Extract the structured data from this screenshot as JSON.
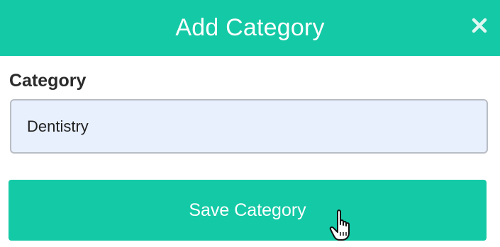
{
  "modal": {
    "title": "Add Category",
    "close_icon": "close-icon"
  },
  "form": {
    "category_label": "Category",
    "category_value": "Dentistry"
  },
  "actions": {
    "save_label": "Save Category"
  },
  "theme": {
    "accent": "#14c9a6",
    "input_background": "#e8f0fe"
  },
  "pointer": {
    "icon": "hand-pointer-icon"
  }
}
